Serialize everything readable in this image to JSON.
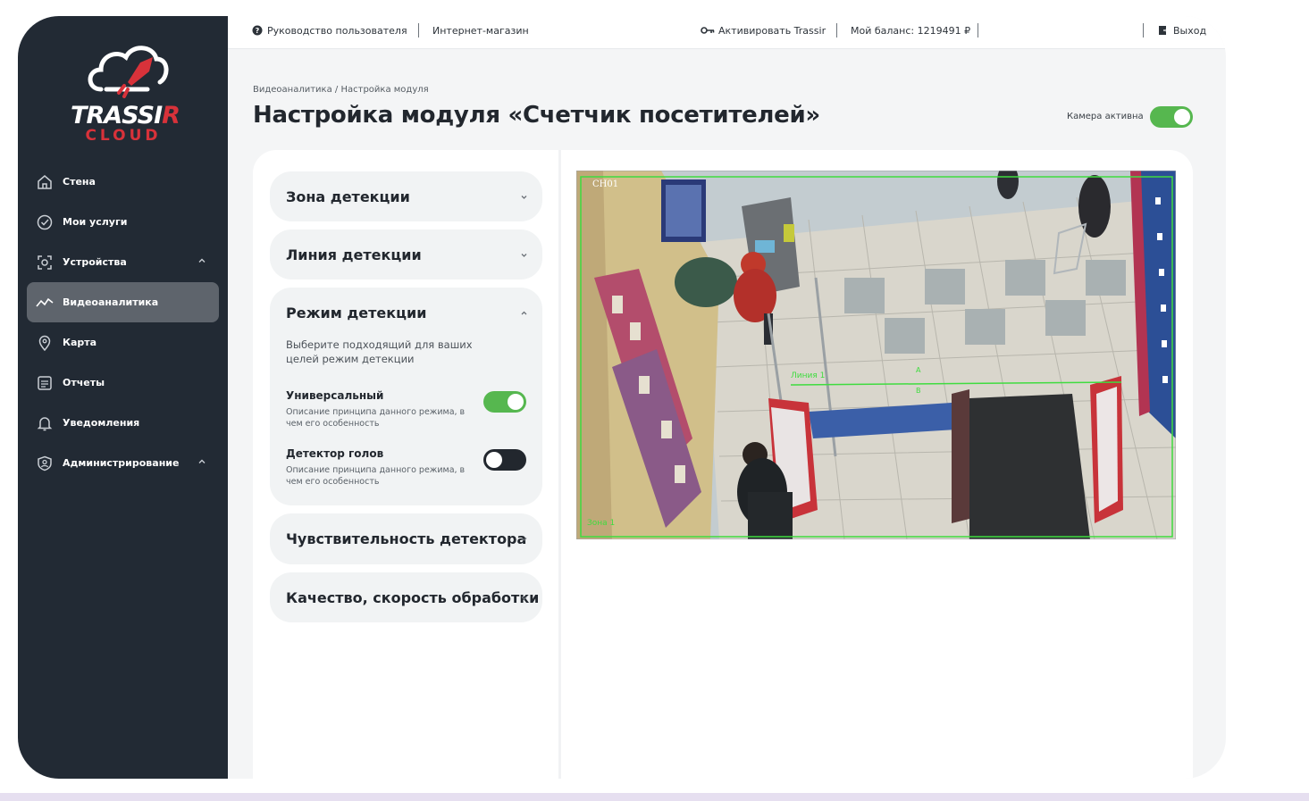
{
  "brand": {
    "word_main": "TRASSI",
    "word_r": "R",
    "word_sub": "CLOUD",
    "accent": "#d8323a"
  },
  "sidebar": {
    "items": [
      {
        "label": "Стена",
        "icon": "home-icon",
        "chevron": false,
        "active": false
      },
      {
        "label": "Мои услуги",
        "icon": "check-circle-icon",
        "chevron": false,
        "active": false
      },
      {
        "label": "Устройства",
        "icon": "camera-focus-icon",
        "chevron": true,
        "active": false
      },
      {
        "label": "Видеоаналитика",
        "icon": "analytics-line-icon",
        "chevron": false,
        "active": true
      },
      {
        "label": "Карта",
        "icon": "map-pin-icon",
        "chevron": false,
        "active": false
      },
      {
        "label": "Отчеты",
        "icon": "report-icon",
        "chevron": false,
        "active": false
      },
      {
        "label": "Уведомления",
        "icon": "bell-icon",
        "chevron": false,
        "active": false
      },
      {
        "label": "Администрирование",
        "icon": "shield-user-icon",
        "chevron": true,
        "active": false
      }
    ]
  },
  "topbar": {
    "guide": "Руководство пользователя",
    "shop": "Интернет-магазин",
    "activate": "Активировать Trassir",
    "balance": "Мой баланс: 1219491 ₽",
    "logout": "Выход"
  },
  "breadcrumb": {
    "parent": "Видеоаналитика",
    "separator": "/",
    "current": "Настройка модуля"
  },
  "page_title": "Настройка модуля «Счетчик посетителей»",
  "camera_active": {
    "label": "Камера активна",
    "on": true
  },
  "accordion": {
    "zone": {
      "title": "Зона детекции",
      "expanded": false
    },
    "line": {
      "title": "Линия детекции",
      "expanded": false
    },
    "mode": {
      "title": "Режим детекции",
      "expanded": true,
      "description": "Выберите подходящий для ваших целей режим детекции",
      "options": [
        {
          "title": "Универсальный",
          "description": "Описание принципа данного режима, в чем его особенность",
          "on": true
        },
        {
          "title": "Детектор голов",
          "description": "Описание принципа данного режима, в чем его особенность",
          "on": false
        }
      ]
    },
    "sensitivity": {
      "title": "Чувствительность детектора",
      "expanded": false
    },
    "quality": {
      "title": "Качество, скорость обработки",
      "expanded": false
    }
  },
  "camera": {
    "channel": "CH01",
    "zone_label": "Зона 1",
    "line_label": "Линия 1",
    "label_a": "A",
    "label_b": "B",
    "overlay_color": "#3fdc3f"
  },
  "colors": {
    "sidebar_bg": "#222a34",
    "toggle_on": "#56b74f",
    "toggle_off": "#22272e",
    "progress": "#2f8fd6"
  }
}
